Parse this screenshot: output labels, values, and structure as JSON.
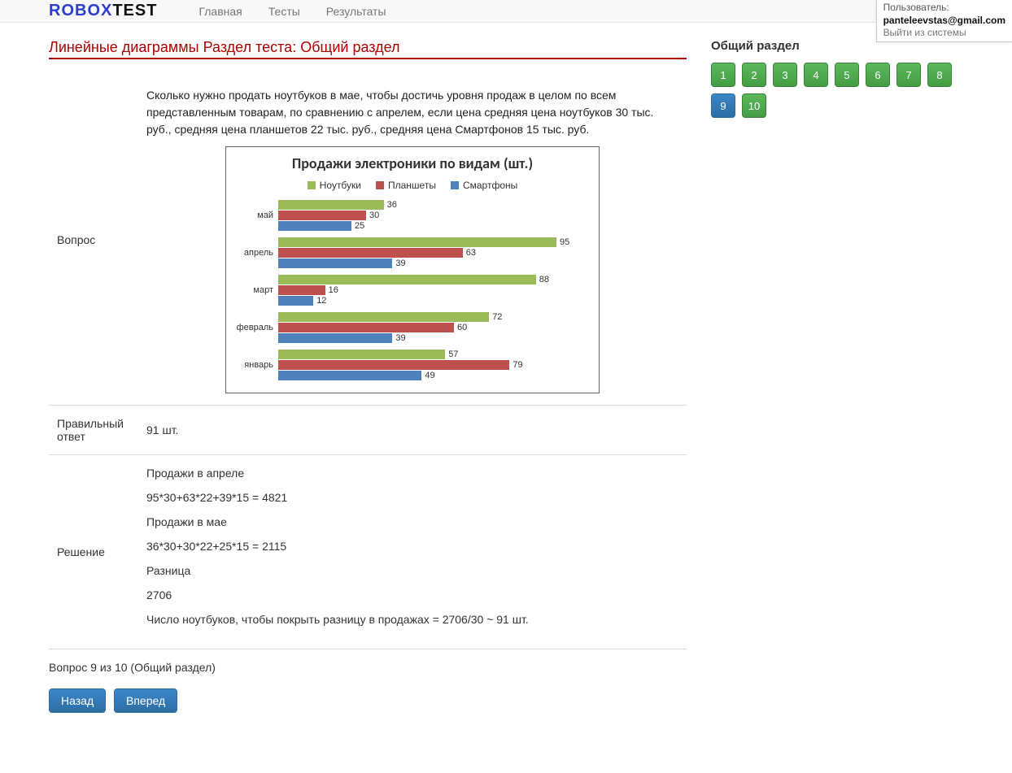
{
  "brand": {
    "part1": "ROBOX",
    "part2": "TEST"
  },
  "nav": {
    "home": "Главная",
    "tests": "Тесты",
    "results": "Результаты"
  },
  "userbox": {
    "label": "Пользователь:",
    "email": "panteleevstas@gmail.com",
    "logout": "Выйти из системы"
  },
  "page": {
    "title": "Линейные диаграммы Раздел теста: Общий раздел"
  },
  "question": {
    "label": "Вопрос",
    "text": "Сколько нужно продать ноутбуков в мае, чтобы достичь уровня продаж в целом по всем представленным товарам, по сравнению с апрелем, если цена средняя цена ноутбуков 30 тыс. руб., средняя цена планшетов 22 тыс. руб., средняя цена Смартфонов 15 тыс. руб."
  },
  "answer": {
    "label": "Правильный ответ",
    "value": "91 шт."
  },
  "solution": {
    "label": "Решение",
    "lines": [
      "Продажи в апреле",
      "95*30+63*22+39*15 = 4821",
      "Продажи в мае",
      "36*30+30*22+25*15 = 2115",
      "Разница",
      "2706",
      "Число ноутбуков, чтобы покрыть разницу в продажах = 2706/30 ~ 91 шт."
    ]
  },
  "progress": "Вопрос 9 из 10 (Общий раздел)",
  "buttons": {
    "back": "Назад",
    "next": "Вперед"
  },
  "sidebar": {
    "title": "Общий раздел",
    "items": [
      "1",
      "2",
      "3",
      "4",
      "5",
      "6",
      "7",
      "8",
      "9",
      "10"
    ],
    "active": 9
  },
  "chart_data": {
    "type": "bar",
    "orientation": "horizontal",
    "title": "Продажи электроники по видам (шт.)",
    "categories": [
      "май",
      "апрель",
      "март",
      "февраль",
      "январь"
    ],
    "series": [
      {
        "name": "Ноутбуки",
        "color": "#9bbb59",
        "values": [
          36,
          95,
          88,
          72,
          57
        ]
      },
      {
        "name": "Планшеты",
        "color": "#c0504d",
        "values": [
          30,
          63,
          16,
          60,
          79
        ]
      },
      {
        "name": "Смартфоны",
        "color": "#4f81bd",
        "values": [
          25,
          39,
          12,
          39,
          49
        ]
      }
    ],
    "xmax": 100
  }
}
